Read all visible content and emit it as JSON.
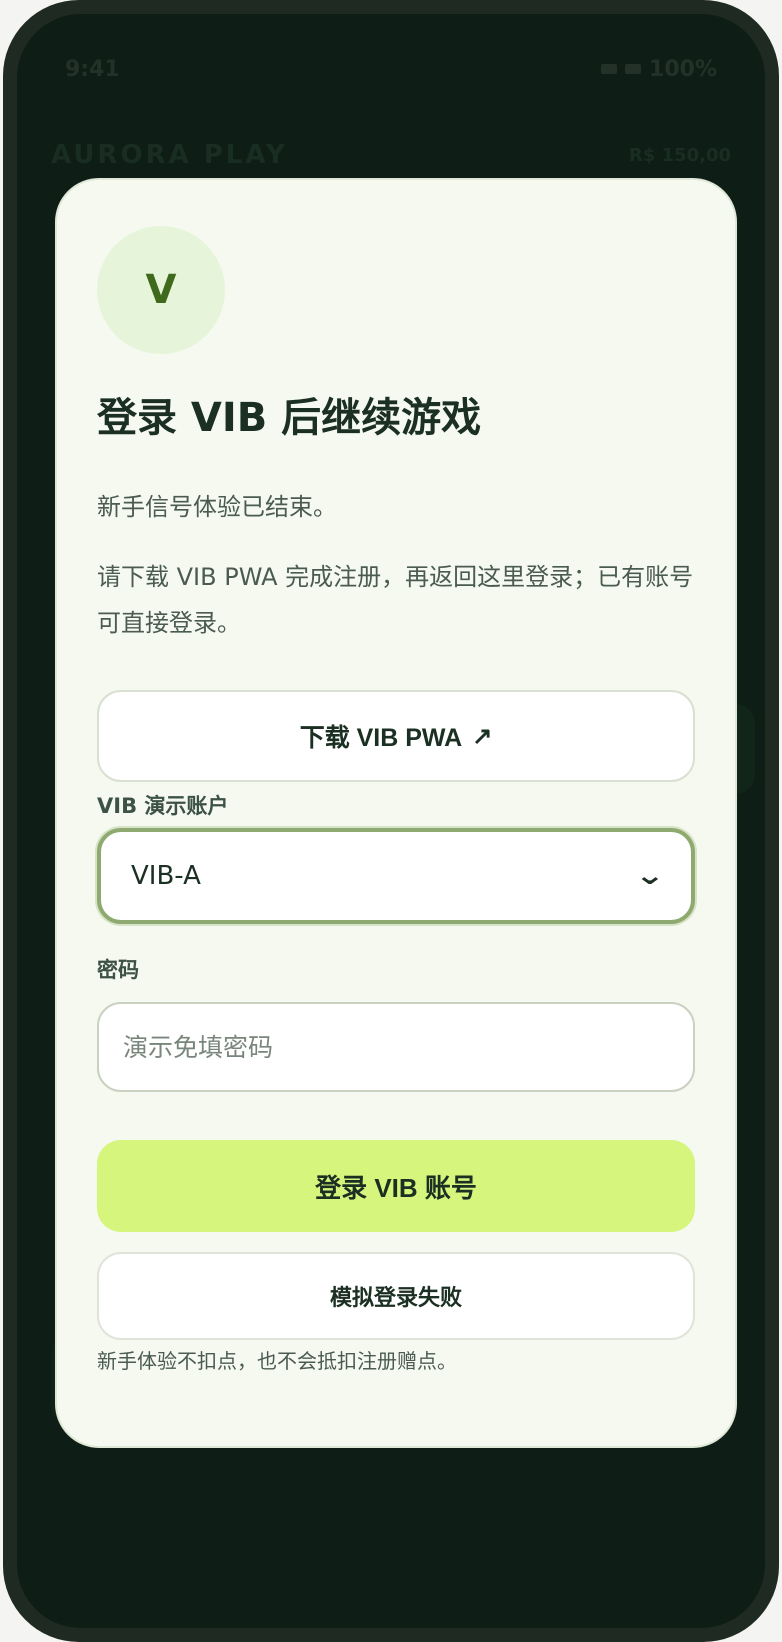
{
  "status_bar": {
    "time": "9:41",
    "battery": "100%"
  },
  "app_bar": {
    "brand": "AURORA PLAY",
    "balance": "R$ 150,00"
  },
  "modal": {
    "avatar_letter": "V",
    "title": "登录 VIB 后继续游戏",
    "paragraph1": "新手信号体验已结束。",
    "paragraph2": "请下载 VIB PWA 完成注册，再返回这里登录；已有账号可直接登录。",
    "download_label": "下载 VIB PWA",
    "download_icon": "arrow-up-right-icon",
    "account_label": "VIB 演示账户",
    "account_selected": "VIB-A",
    "password_label": "密码",
    "password_placeholder": "演示免填密码",
    "login_label": "登录 VIB 账号",
    "fail_label": "模拟登录失败",
    "footnote": "新手体验不扣点，也不会抵扣注册赠点。"
  },
  "colors": {
    "accent": "#d6f57c",
    "modal_bg": "#f5f9ef",
    "screen_bg": "#0f2018",
    "text": "#1b2f23"
  }
}
